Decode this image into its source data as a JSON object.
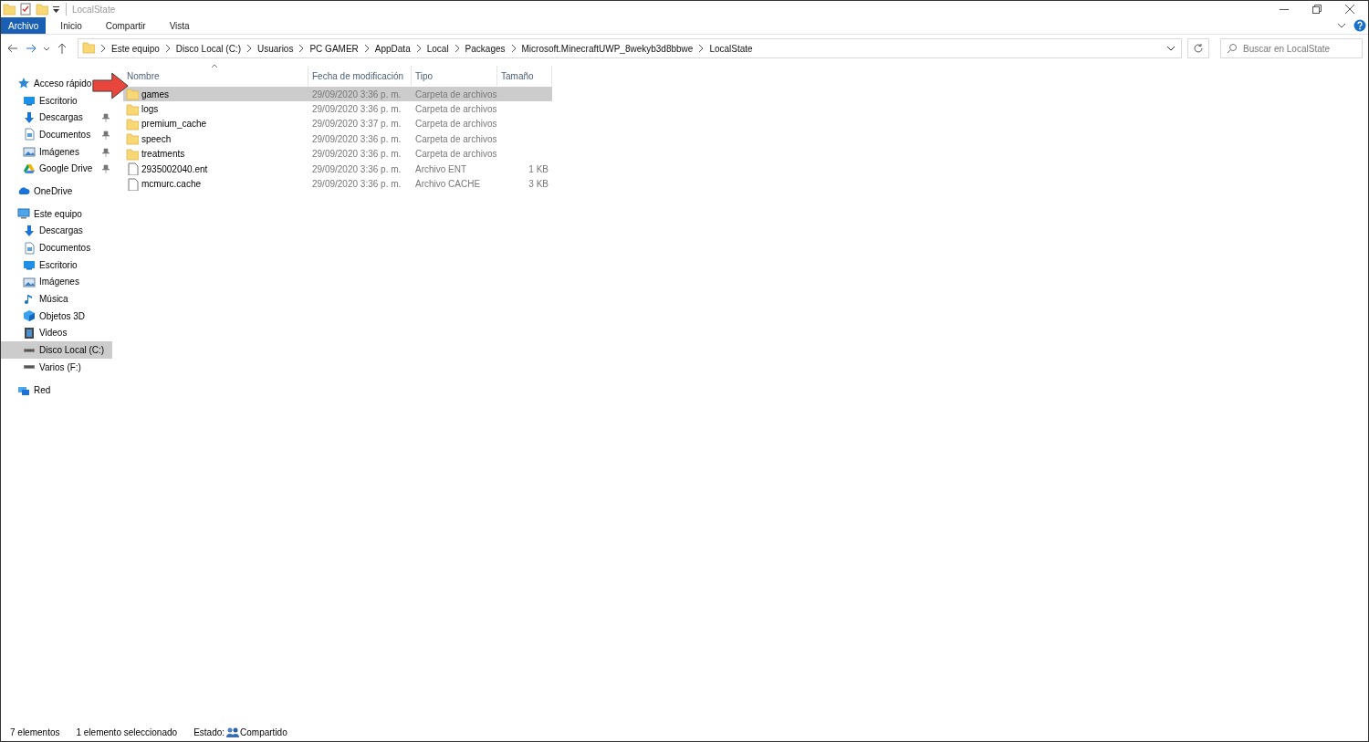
{
  "window": {
    "title": "LocalState"
  },
  "ribbon_tabs": [
    {
      "label": "Archivo",
      "selected": true
    },
    {
      "label": "Inicio",
      "selected": false
    },
    {
      "label": "Compartir",
      "selected": false
    },
    {
      "label": "Vista",
      "selected": false
    }
  ],
  "breadcrumb": [
    "Este equipo",
    "Disco Local (C:)",
    "Usuarios",
    "PC GAMER",
    "AppData",
    "Local",
    "Packages",
    "Microsoft.MinecraftUWP_8wekyb3d8bbwe",
    "LocalState"
  ],
  "search": {
    "placeholder": "Buscar en LocalState"
  },
  "nav": [
    {
      "label": "Acceso rápido",
      "kind": "star",
      "selected": false,
      "children": [
        {
          "label": "Escritorio",
          "kind": "desktop",
          "pinned": false,
          "selected": false
        },
        {
          "label": "Descargas",
          "kind": "download",
          "pinned": true,
          "selected": false
        },
        {
          "label": "Documentos",
          "kind": "document",
          "pinned": true,
          "selected": false
        },
        {
          "label": "Imágenes",
          "kind": "pictures",
          "pinned": true,
          "selected": false
        },
        {
          "label": "Google Drive",
          "kind": "drive",
          "pinned": true,
          "selected": false
        }
      ]
    },
    {
      "label": "OneDrive",
      "kind": "cloud",
      "selected": false
    },
    {
      "label": "Este equipo",
      "kind": "pc",
      "selected": false,
      "children": [
        {
          "label": "Descargas",
          "kind": "download",
          "pinned": false,
          "selected": false
        },
        {
          "label": "Documentos",
          "kind": "document",
          "pinned": false,
          "selected": false
        },
        {
          "label": "Escritorio",
          "kind": "desktop",
          "pinned": false,
          "selected": false
        },
        {
          "label": "Imágenes",
          "kind": "pictures",
          "pinned": false,
          "selected": false
        },
        {
          "label": "Música",
          "kind": "music",
          "pinned": false,
          "selected": false
        },
        {
          "label": "Objetos 3D",
          "kind": "cube",
          "pinned": false,
          "selected": false
        },
        {
          "label": "Videos",
          "kind": "video",
          "pinned": false,
          "selected": false
        },
        {
          "label": "Disco Local (C:)",
          "kind": "disk",
          "pinned": false,
          "selected": true
        },
        {
          "label": "Varios (F:)",
          "kind": "disk",
          "pinned": false,
          "selected": false
        }
      ]
    },
    {
      "label": "Red",
      "kind": "network",
      "selected": false
    }
  ],
  "table": {
    "columns": [
      "Nombre",
      "Fecha de modificación",
      "Tipo",
      "Tamaño"
    ],
    "rows": [
      {
        "name": "games",
        "kind": "folder",
        "date": "29/09/2020 3:36 p. m.",
        "type": "Carpeta de archivos",
        "size": "",
        "selected": true
      },
      {
        "name": "logs",
        "kind": "folder",
        "date": "29/09/2020 3:36 p. m.",
        "type": "Carpeta de archivos",
        "selected": false
      },
      {
        "name": "premium_cache",
        "kind": "folder",
        "date": "29/09/2020 3:37 p. m.",
        "type": "Carpeta de archivos",
        "selected": false
      },
      {
        "name": "speech",
        "kind": "folder",
        "date": "29/09/2020 3:36 p. m.",
        "type": "Carpeta de archivos",
        "selected": false
      },
      {
        "name": "treatments",
        "kind": "folder",
        "date": "29/09/2020 3:36 p. m.",
        "type": "Carpeta de archivos",
        "selected": false
      },
      {
        "name": "2935002040.ent",
        "kind": "file",
        "date": "29/09/2020 3:36 p. m.",
        "type": "Archivo ENT",
        "size": "1 KB",
        "selected": false
      },
      {
        "name": "mcmurc.cache",
        "kind": "file",
        "date": "29/09/2020 3:36 p. m.",
        "type": "Archivo CACHE",
        "size": "3 KB",
        "selected": false
      }
    ]
  },
  "status_bar": {
    "count": "7 elementos",
    "selection": "1 elemento seleccionado",
    "state_label": "Estado:",
    "state_value": "Compartido"
  }
}
